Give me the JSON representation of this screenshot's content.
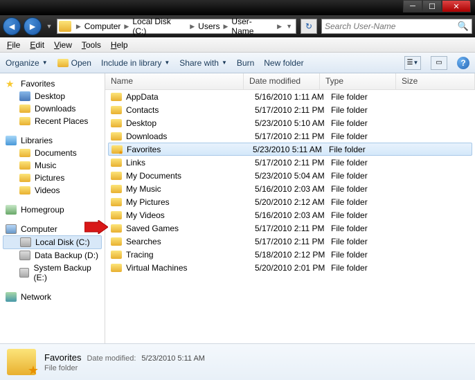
{
  "window": {
    "title": "User-Name"
  },
  "breadcrumbs": [
    "Computer",
    "Local Disk (C:)",
    "Users",
    "User-Name"
  ],
  "search_placeholder": "Search User-Name",
  "menus": {
    "file": "File",
    "edit": "Edit",
    "view": "View",
    "tools": "Tools",
    "help": "Help"
  },
  "toolbar": {
    "organize": "Organize",
    "open": "Open",
    "include": "Include in library",
    "share": "Share with",
    "burn": "Burn",
    "newfolder": "New folder"
  },
  "sidebar": {
    "favorites": {
      "label": "Favorites",
      "items": [
        "Desktop",
        "Downloads",
        "Recent Places"
      ]
    },
    "libraries": {
      "label": "Libraries",
      "items": [
        "Documents",
        "Music",
        "Pictures",
        "Videos"
      ]
    },
    "homegroup": "Homegroup",
    "computer": {
      "label": "Computer",
      "items": [
        "Local Disk (C:)",
        "Data Backup (D:)",
        "System Backup (E:)"
      ]
    },
    "network": "Network"
  },
  "columns": {
    "name": "Name",
    "date": "Date modified",
    "type": "Type",
    "size": "Size"
  },
  "files": [
    {
      "name": "AppData",
      "date": "5/16/2010 1:11 AM",
      "type": "File folder"
    },
    {
      "name": "Contacts",
      "date": "5/17/2010 2:11 PM",
      "type": "File folder"
    },
    {
      "name": "Desktop",
      "date": "5/23/2010 5:10 AM",
      "type": "File folder"
    },
    {
      "name": "Downloads",
      "date": "5/17/2010 2:11 PM",
      "type": "File folder"
    },
    {
      "name": "Favorites",
      "date": "5/23/2010 5:11 AM",
      "type": "File folder",
      "sel": true,
      "fav": true
    },
    {
      "name": "Links",
      "date": "5/17/2010 2:11 PM",
      "type": "File folder"
    },
    {
      "name": "My Documents",
      "date": "5/23/2010 5:04 AM",
      "type": "File folder"
    },
    {
      "name": "My Music",
      "date": "5/16/2010 2:03 AM",
      "type": "File folder"
    },
    {
      "name": "My Pictures",
      "date": "5/20/2010 2:12 AM",
      "type": "File folder"
    },
    {
      "name": "My Videos",
      "date": "5/16/2010 2:03 AM",
      "type": "File folder"
    },
    {
      "name": "Saved Games",
      "date": "5/17/2010 2:11 PM",
      "type": "File folder"
    },
    {
      "name": "Searches",
      "date": "5/17/2010 2:11 PM",
      "type": "File folder"
    },
    {
      "name": "Tracing",
      "date": "5/18/2010 2:12 PM",
      "type": "File folder"
    },
    {
      "name": "Virtual Machines",
      "date": "5/20/2010 2:01 PM",
      "type": "File folder"
    }
  ],
  "details": {
    "title": "Favorites",
    "date_label": "Date modified:",
    "date_value": "5/23/2010 5:11 AM",
    "type": "File folder"
  }
}
